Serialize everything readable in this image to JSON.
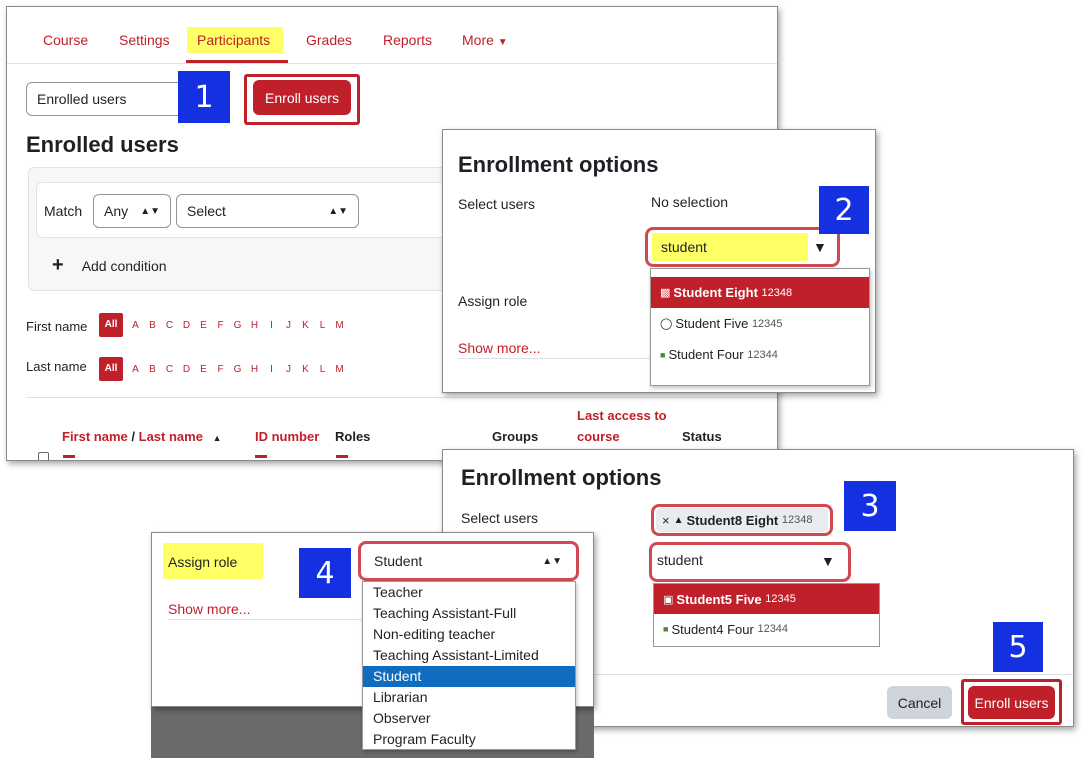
{
  "course_nav": {
    "tabs": [
      "Course",
      "Settings",
      "Participants",
      "Grades",
      "Reports",
      "More"
    ],
    "active_tab": "Participants"
  },
  "participants": {
    "enrolled_select": "Enrolled users",
    "enroll_button": "Enroll users",
    "heading": "Enrolled users",
    "filter": {
      "match_label": "Match",
      "match_value": "Any",
      "select_value": "Select",
      "add_condition": "Add condition"
    },
    "first_name_label": "First name",
    "last_name_label": "Last name",
    "letters": [
      "All",
      "A",
      "B",
      "C",
      "D",
      "E",
      "F",
      "G",
      "H",
      "I",
      "J",
      "K",
      "L",
      "M"
    ],
    "columns": {
      "first_name": "First name",
      "slash": "/",
      "last_name": "Last name",
      "id_number": "ID number",
      "roles": "Roles",
      "groups": "Groups",
      "last_access_1": "Last access to",
      "last_access_2": "course",
      "status": "Status"
    }
  },
  "modal1": {
    "title": "Enrollment options",
    "select_users_label": "Select users",
    "no_selection": "No selection",
    "search_value": "student",
    "assign_role_label": "Assign role",
    "show_more": "Show more...",
    "results": [
      {
        "name": "Student Eight",
        "id": "12348"
      },
      {
        "name": "Student Five",
        "id": "12345"
      },
      {
        "name": "Student Four",
        "id": "12344"
      }
    ]
  },
  "modal2": {
    "title": "Enrollment options",
    "select_users_label": "Select users",
    "chip_remove": "×",
    "chip_name": "Student8 Eight",
    "chip_id": "12348",
    "search_value": "student",
    "results": [
      {
        "name": "Student5 Five",
        "id": "12345"
      },
      {
        "name": "Student4 Four",
        "id": "12344"
      }
    ],
    "cancel_button": "Cancel",
    "enroll_button": "Enroll users"
  },
  "role_panel": {
    "assign_role_label": "Assign role",
    "selected_role": "Student",
    "show_more": "Show more...",
    "options": [
      "Teacher",
      "Teaching Assistant-Full",
      "Non-editing teacher",
      "Teaching Assistant-Limited",
      "Student",
      "Librarian",
      "Observer",
      "Program Faculty"
    ]
  },
  "steps": [
    "1",
    "2",
    "3",
    "4",
    "5"
  ],
  "colors": {
    "brand_red": "#c0202a",
    "step_badge": "#1530e0",
    "highlight_yellow": "#ffff66",
    "selected_option": "#0f6cbf"
  }
}
